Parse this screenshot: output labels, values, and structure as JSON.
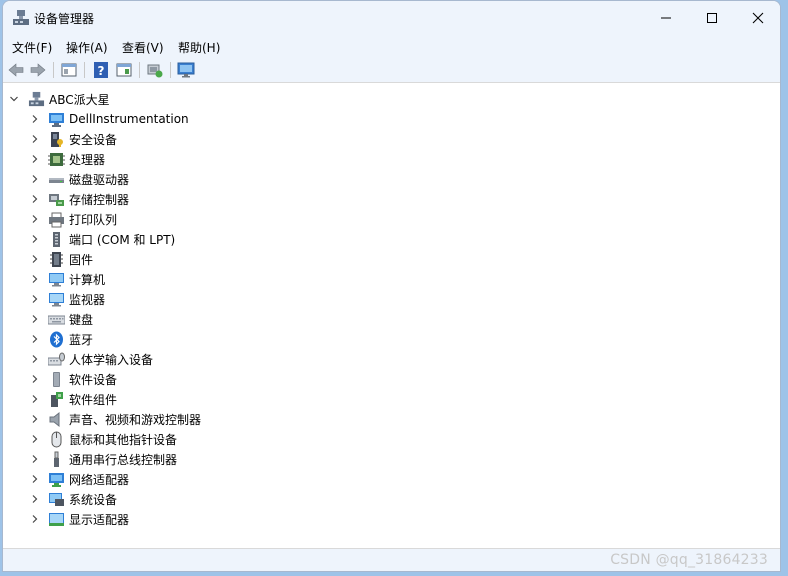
{
  "window": {
    "title": "设备管理器"
  },
  "menu": [
    "文件(F)",
    "操作(A)",
    "查看(V)",
    "帮助(H)"
  ],
  "toolbar": {
    "buttons": [
      "back-arrow-icon",
      "forward-arrow-icon",
      "properties-pane-icon",
      "help-icon",
      "view-pane-icon",
      "scan-hardware-icon",
      "monitor-icon"
    ]
  },
  "tree": {
    "root": "ABC派大星",
    "items": [
      {
        "label": "DellInstrumentation",
        "icon": "network-monitor-icon"
      },
      {
        "label": "安全设备",
        "icon": "security-key-icon"
      },
      {
        "label": "处理器",
        "icon": "processor-chip-icon"
      },
      {
        "label": "磁盘驱动器",
        "icon": "disk-drive-icon"
      },
      {
        "label": "存储控制器",
        "icon": "storage-controller-icon"
      },
      {
        "label": "打印队列",
        "icon": "printer-icon"
      },
      {
        "label": "端口 (COM 和 LPT)",
        "icon": "port-icon"
      },
      {
        "label": "固件",
        "icon": "firmware-icon"
      },
      {
        "label": "计算机",
        "icon": "computer-icon"
      },
      {
        "label": "监视器",
        "icon": "monitor-icon"
      },
      {
        "label": "键盘",
        "icon": "keyboard-icon"
      },
      {
        "label": "蓝牙",
        "icon": "bluetooth-icon"
      },
      {
        "label": "人体学输入设备",
        "icon": "hid-icon"
      },
      {
        "label": "软件设备",
        "icon": "software-device-icon"
      },
      {
        "label": "软件组件",
        "icon": "software-component-icon"
      },
      {
        "label": "声音、视频和游戏控制器",
        "icon": "speaker-icon"
      },
      {
        "label": "鼠标和其他指针设备",
        "icon": "mouse-icon"
      },
      {
        "label": "通用串行总线控制器",
        "icon": "usb-icon"
      },
      {
        "label": "网络适配器",
        "icon": "network-adapter-icon"
      },
      {
        "label": "系统设备",
        "icon": "system-device-icon"
      },
      {
        "label": "显示适配器",
        "icon": "display-adapter-icon"
      }
    ]
  },
  "watermark": "CSDN @qq_31864233"
}
